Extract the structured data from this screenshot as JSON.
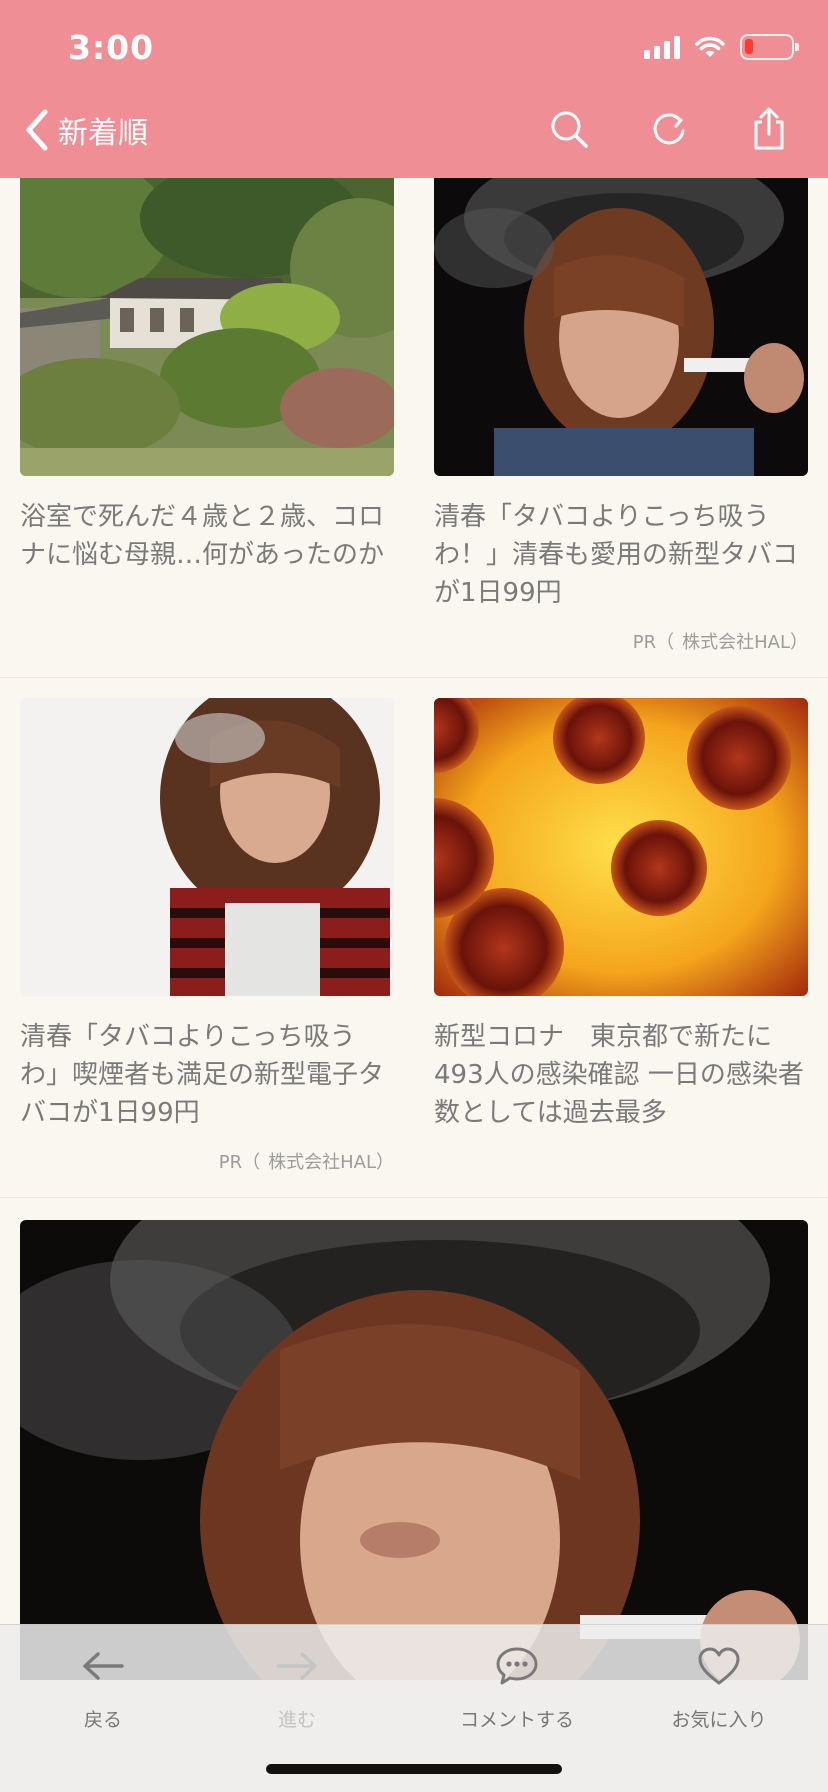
{
  "status_bar": {
    "time": "3:00"
  },
  "nav": {
    "back_icon": "chevron-left-icon",
    "title": "新着順",
    "icons": [
      "search-icon",
      "refresh-icon",
      "share-icon"
    ]
  },
  "articles": [
    {
      "title": "浴室で死んだ４歳と２歳、コロナに悩む母親…何があったのか",
      "image": "countryside-house-photo"
    },
    {
      "title": "清春「タバコよりこっち吸うわ！」清春も愛用の新型タバコが1日99円",
      "image": "man-hat-smoking-photo",
      "pr": "PR（",
      "sponsor": "株式会社HAL）"
    },
    {
      "title": "清春「タバコよりこっち吸うわ」喫煙者も満足の新型電子タバコが1日99円",
      "image": "man-smoking-photo",
      "pr": "PR（",
      "sponsor": "株式会社HAL）"
    },
    {
      "title": "新型コロナ　東京都で新たに493人の感染確認 一日の感染者数としては過去最多",
      "image": "virus-micrograph-photo"
    }
  ],
  "featured": {
    "image": "man-hat-smoking-large-photo"
  },
  "toolbar": {
    "back": "戻る",
    "forward": "進む",
    "comment": "コメントする",
    "favorite": "お気に入り"
  },
  "colors": {
    "header": "#ef8f95",
    "background": "#faf6f0",
    "text": "#7a7a7a"
  }
}
